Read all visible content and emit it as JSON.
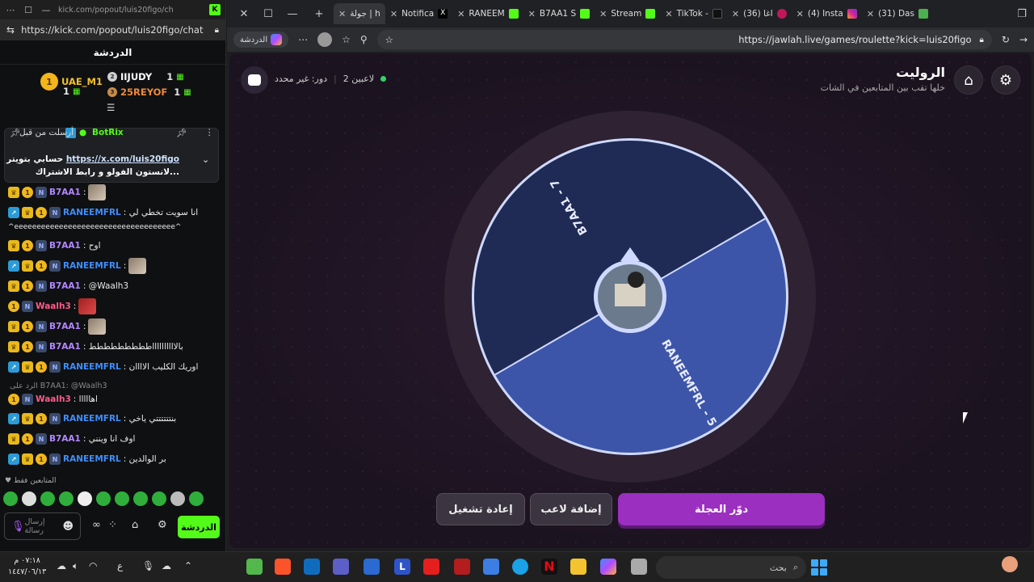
{
  "chat_window": {
    "title_url": "kick.com/popout/luis20figo/ch",
    "url": "https://kick.com/popout/luis20figo/chat",
    "header": "الدردشة",
    "leaderboard": [
      {
        "name": "UAE_M1",
        "count": "1"
      },
      {
        "name": "IIJUDY",
        "count": "1"
      },
      {
        "name": "25REYOF",
        "count": "1"
      }
    ],
    "pinned": {
      "sent_before": "أرسلت من قبل",
      "bot_name": "BotRix",
      "text_prefix": "حسابي بتويتر",
      "link": "https://x.com/luis20figo",
      "text_suffix": "لانستون الفولو و رابط الاشتراك..."
    },
    "messages": [
      {
        "user": "B7AA1",
        "text": ":"
      },
      {
        "user": "RANEEMFRL",
        "text": ": انا سويت تخطي لي"
      },
      {
        "user": "",
        "text": "^eeeeeeeeeeeeeeeeeeeeeeeeeeeeeeeeeeee^"
      },
      {
        "user": "B7AA1",
        "text": ": اوح"
      },
      {
        "user": "RANEEMFRL",
        "text": ":"
      },
      {
        "user": "B7AA1",
        "text": ": @Waalh3"
      },
      {
        "user": "Waalh3",
        "text": ":"
      },
      {
        "user": "B7AA1",
        "text": ":"
      },
      {
        "user": "B7AA1",
        "text": ": بالااااااااااططططططططط"
      },
      {
        "user": "RANEEMFRL",
        "text": ": اوريك الكليب الاااان"
      },
      {
        "user": "Waalh3",
        "text": ": اهااااا"
      },
      {
        "user": "RANEEMFRL",
        "text": ": بنتتتتتتي ياخي"
      },
      {
        "user": "B7AA1",
        "text": ": اوف انا وينني"
      },
      {
        "user": "RANEEMFRL",
        "text": ": بر الوالدين"
      }
    ],
    "reply_note": "الرد على B7AA1: @Waalh3",
    "followers_only": "المتابعين فقط",
    "send_placeholder": "إرسال رسالة",
    "chat_button": "الدردشة"
  },
  "browser": {
    "tabs": [
      {
        "label": "جولة | h",
        "active": true
      },
      {
        "label": "Notifica"
      },
      {
        "label": "RANEEM"
      },
      {
        "label": "B7AA1 S"
      },
      {
        "label": "Stream"
      },
      {
        "label": "TikTok -"
      },
      {
        "label": "(36) اغا"
      },
      {
        "label": "(4) Insta"
      },
      {
        "label": "(31) Das"
      }
    ],
    "copilot_label": "الدردشة",
    "url": "https://jawlah.live/games/roulette?kick=luis20figo"
  },
  "game": {
    "title": "الروليت",
    "subtitle": "خلها تقب بين المتابعين في الشات",
    "players_count": "2 لاعبين",
    "turn": "دور: غير محدد",
    "segments": [
      {
        "label": "B7AA1 - 7",
        "color": "#1f2b55"
      },
      {
        "label": "RANEEMFRL - 5",
        "color": "#3d55a8"
      }
    ],
    "buttons": {
      "spin": "دوّر العجلة",
      "add_player": "إضافة لاعب",
      "reset": "إعادة تشغيل"
    }
  },
  "taskbar": {
    "time": "٠٧:١٨ م",
    "date": "١٤٤٧/٠٦/١٣",
    "search_placeholder": "بحث",
    "lang": "ع"
  }
}
